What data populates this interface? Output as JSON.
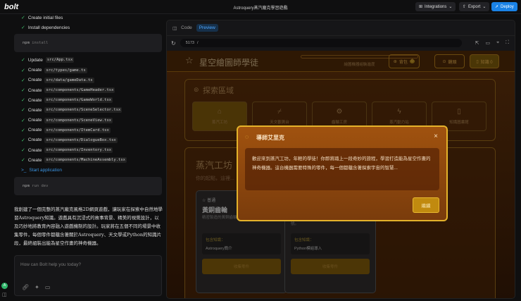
{
  "header": {
    "logo": "bolt",
    "project_title": "Astroquery蒸汽龐克學習遊戲",
    "integrations": "Integrations",
    "export": "Export",
    "deploy": "Deploy"
  },
  "chat": {
    "steps_top": [
      {
        "verb": "Create initial files"
      },
      {
        "verb": "Install dependencies"
      }
    ],
    "cmd1": {
      "a": "npm",
      "b": "install"
    },
    "steps": [
      {
        "verb": "Update",
        "file": "src/App.tsx"
      },
      {
        "verb": "Create",
        "file": "src/types/game.ts"
      },
      {
        "verb": "Create",
        "file": "src/data/gameData.ts"
      },
      {
        "verb": "Create",
        "file": "src/components/GameHeader.tsx"
      },
      {
        "verb": "Create",
        "file": "src/components/GameWorld.tsx"
      },
      {
        "verb": "Create",
        "file": "src/components/SceneSelector.tsx"
      },
      {
        "verb": "Create",
        "file": "src/components/SceneView.tsx"
      },
      {
        "verb": "Create",
        "file": "src/components/ItemCard.tsx"
      },
      {
        "verb": "Create",
        "file": "src/components/DialogueBox.tsx"
      },
      {
        "verb": "Create",
        "file": "src/components/Inventory.tsx"
      },
      {
        "verb": "Create",
        "file": "src/components/MachineAssembly.tsx"
      }
    ],
    "start": "Start application",
    "cmd2": {
      "a": "npm",
      "b": "run dev"
    },
    "message": "我創建了一個完整的蒸汽龐克風格2D網頁遊戲，讓玩家在探索中自然地學習Astroquery知識。遊戲具有沉浸式的故事背景、精美的視覺設計，以及巧妙地將教育內容融入遊戲機制的設計。玩家將在五個不同的場景中收集零件，每個零件都蘊含著關於Astroquery、天文學或Python的知識片段，最終組裝出能為星空作畫的神奇機器。",
    "placeholder": "How can Bolt help you today?",
    "avatar": "A"
  },
  "preview": {
    "tab_code": "Code",
    "tab_preview": "Preview",
    "port": "5173",
    "path": "/"
  },
  "game": {
    "title": "星空繪圖師學徒",
    "progress_label": "繪圖機器組裝進度",
    "progress": 0,
    "btn_bag": "背包",
    "bag_count": "0",
    "btn_lens": "鏡頭",
    "btn_knowledge": "知識 0",
    "explore_title": "探索區域",
    "scenes": [
      {
        "label": "蒸汽工坊"
      },
      {
        "label": "天文觀測台"
      },
      {
        "label": "齒輪工房"
      },
      {
        "label": "蒸汽動力站"
      },
      {
        "label": "知識圖書館"
      }
    ],
    "scene_title": "蒸汽工坊",
    "scene_desc": "你的起點，這裡...",
    "cards": [
      {
        "tag": "普通",
        "name": "黃銅齒輪",
        "desc": "精密製造的黃銅齒輪，能讓機器轉動順暢。",
        "klabel": "包含知識：",
        "knowledge": "Astroquery簡介",
        "button": "收集零件"
      },
      {
        "tag": "",
        "name": "",
        "desc": "用來增強能力的精密零件，內部刻有神秘符號。",
        "klabel": "包含知識：",
        "knowledge": "Python模組導入",
        "button": "收集零件"
      }
    ]
  },
  "dialog": {
    "title": "導師艾里克",
    "text": "歡迎來到蒸汽工坊，年輕的學徒！你即將踏上一段奇妙的旅程，學習打造能為星空作畫的神奇機器。這台機器需要特殊的零件，每一個都蘊含著探索宇宙的智慧...",
    "continue": "繼續"
  }
}
